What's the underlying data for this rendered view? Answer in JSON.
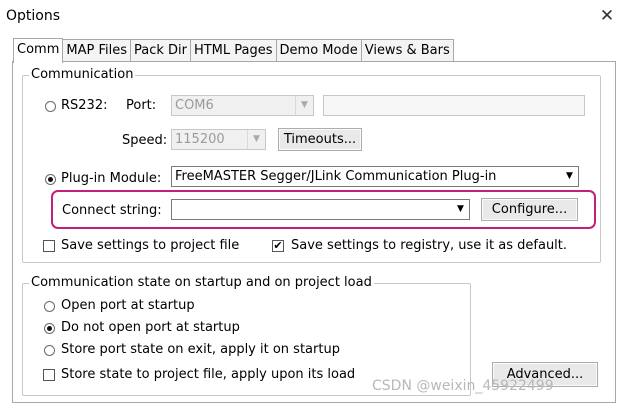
{
  "window": {
    "title": "Options",
    "close_glyph": "✕"
  },
  "tabs": [
    "Comm",
    "MAP Files",
    "Pack Dir",
    "HTML Pages",
    "Demo Mode",
    "Views & Bars"
  ],
  "communication": {
    "legend": "Communication",
    "rs232": {
      "label": "RS232:",
      "port_label": "Port:",
      "port_value": "COM6",
      "port_text": "",
      "speed_label": "Speed:",
      "speed_value": "115200",
      "timeouts_button": "Timeouts..."
    },
    "plugin": {
      "label": "Plug-in Module:",
      "value": "FreeMASTER Segger/JLink Communication Plug-in"
    },
    "connect": {
      "label": "Connect string:",
      "value": "",
      "configure_button": "Configure..."
    },
    "save_project": {
      "label": "Save settings to project file",
      "checked": false
    },
    "save_registry": {
      "label": "Save settings to registry, use it as default.",
      "checked": true
    }
  },
  "startup": {
    "legend": "Communication state on startup and on project load",
    "options": [
      "Open port at startup",
      "Do not open port at startup",
      "Store port state on exit, apply it on startup"
    ],
    "selected": "Do not open port at startup",
    "store_state": {
      "label": "Store state to project file, apply upon its load",
      "checked": false
    }
  },
  "advanced_button": "Advanced...",
  "watermark": "CSDN @weixin_45922499",
  "colors": {
    "highlight": "#c2207a",
    "border": "#a8a8a8"
  }
}
